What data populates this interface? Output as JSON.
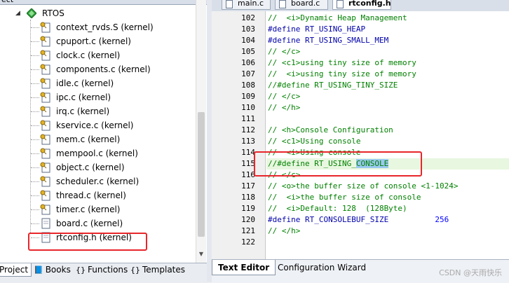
{
  "project_panel": {
    "title": "ect",
    "group": {
      "name": "RTOS",
      "icon": "diamond-group-icon"
    },
    "files": [
      "context_rvds.S (kernel)",
      "cpuport.c (kernel)",
      "clock.c (kernel)",
      "components.c (kernel)",
      "idle.c (kernel)",
      "ipc.c (kernel)",
      "irq.c (kernel)",
      "kservice.c (kernel)",
      "mem.c (kernel)",
      "mempool.c (kernel)",
      "object.c (kernel)",
      "scheduler.c (kernel)",
      "thread.c (kernel)",
      "timer.c (kernel)",
      "board.c (kernel)",
      "rtconfig.h (kernel)"
    ],
    "tabs": [
      "Project",
      "Books",
      "Functions",
      "Templates"
    ]
  },
  "editor_tabs": [
    "main.c",
    "board.c",
    "rtconfig.h"
  ],
  "editor": {
    "lines": [
      {
        "n": "102",
        "text": "//  <i>Dynamic Heap Management",
        "kind": "cmt"
      },
      {
        "n": "103",
        "text": "#define RT_USING_HEAP",
        "kind": "pp"
      },
      {
        "n": "104",
        "text": "#define RT_USING_SMALL_MEM",
        "kind": "pp"
      },
      {
        "n": "105",
        "text": "// </c>",
        "kind": "cmt"
      },
      {
        "n": "106",
        "text": "// <c1>using tiny size of memory",
        "kind": "cmt"
      },
      {
        "n": "107",
        "text": "//  <i>using tiny size of memory",
        "kind": "cmt"
      },
      {
        "n": "108",
        "text": "//#define RT_USING_TINY_SIZE",
        "kind": "cmt"
      },
      {
        "n": "109",
        "text": "// </c>",
        "kind": "cmt"
      },
      {
        "n": "110",
        "text": "// </h>",
        "kind": "cmt"
      },
      {
        "n": "111",
        "text": "",
        "kind": "cmt"
      },
      {
        "n": "112",
        "text": "// <h>Console Configuration",
        "kind": "cmt"
      },
      {
        "n": "113",
        "text": "// <c1>Using console",
        "kind": "cmt"
      },
      {
        "n": "114",
        "text": "//  <i>Using console",
        "kind": "cmt"
      },
      {
        "n": "115",
        "text": "//#define RT_USING_",
        "kind": "cmt",
        "selected": "CONSOLE"
      },
      {
        "n": "116",
        "text": "// </c>",
        "kind": "cmt"
      },
      {
        "n": "117",
        "text": "// <o>the buffer size of console <1-1024>",
        "kind": "cmt"
      },
      {
        "n": "118",
        "text": "//  <i>the buffer size of console",
        "kind": "cmt"
      },
      {
        "n": "119",
        "text": "//  <i>Default: 128  (128Byte)",
        "kind": "cmt"
      },
      {
        "n": "120",
        "text": "#define RT_CONSOLEBUF_SIZE          ",
        "kind": "pp",
        "value": "256"
      },
      {
        "n": "121",
        "text": "// </h>",
        "kind": "cmt"
      },
      {
        "n": "122",
        "text": "",
        "kind": "cmt"
      }
    ]
  },
  "bottom_tabs": [
    "Text Editor",
    "Configuration Wizard"
  ],
  "watermark": "CSDN @天雨快乐",
  "colors": {
    "comment": "#008000",
    "preprocessor": "#0000aa",
    "number": "#0000ff",
    "highlight_box": "#e8262b",
    "selection": "#99c9ef"
  }
}
